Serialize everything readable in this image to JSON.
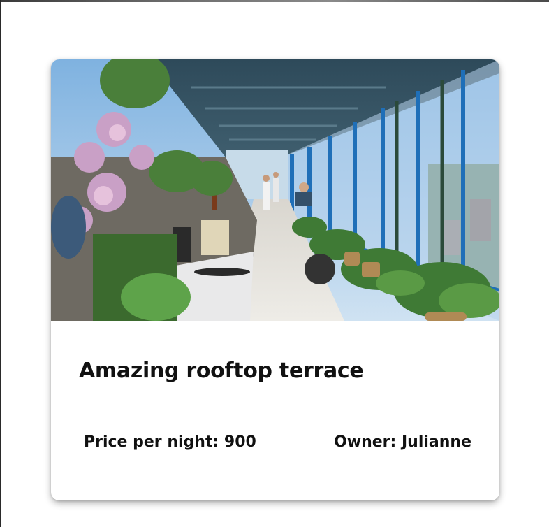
{
  "listing": {
    "title": "Amazing rooftop terrace",
    "price_text": "Price per night: 900",
    "owner_text": "Owner: Julianne",
    "image_alt": "Rooftop terrace restaurant with glass walls, plants and city view"
  },
  "colors": {
    "card_background": "#ffffff",
    "text": "#111111",
    "window_frame_blue": "#1f6fb8",
    "sky": "#9cc3e6"
  }
}
